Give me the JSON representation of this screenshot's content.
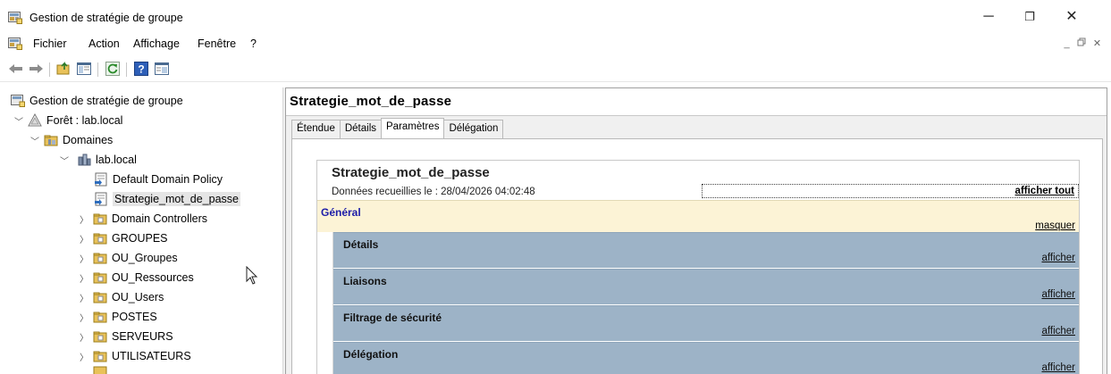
{
  "window": {
    "title": "Gestion de stratégie de groupe",
    "minimize_glyph": "─",
    "restore_glyph": "❐",
    "close_glyph": "✕"
  },
  "menu": {
    "items": [
      "Fichier",
      "Action",
      "Affichage",
      "Fenêtre",
      "?"
    ],
    "mdi_minimize": "_",
    "mdi_restore": "ₑ",
    "mdi_close": "✕"
  },
  "toolbar": {
    "icons": [
      "back-arrow-icon",
      "forward-arrow-icon",
      "up-folder-icon",
      "show-hide-tree-icon",
      "refresh-icon",
      "help-icon",
      "properties-icon"
    ]
  },
  "tree": {
    "root": "Gestion de stratégie de groupe",
    "forest": "Forêt : lab.local",
    "domains": "Domaines",
    "domain": "lab.local",
    "gpos": [
      "Default Domain Policy",
      "Strategie_mot_de_passe"
    ],
    "ous": [
      "Domain Controllers",
      "GROUPES",
      "OU_Groupes",
      "OU_Ressources",
      "OU_Users",
      "POSTES",
      "SERVEURS",
      "UTILISATEURS"
    ]
  },
  "right": {
    "gpo_title": "Strategie_mot_de_passe",
    "tabs": [
      "Étendue",
      "Détails",
      "Paramètres",
      "Délégation"
    ],
    "active_tab": "Paramètres",
    "report": {
      "title": "Strategie_mot_de_passe",
      "date": "Données recueillies le : 28/04/2026 04:02:48",
      "show_all": "afficher tout",
      "general": "Général",
      "hide": "masquer",
      "sections": [
        {
          "label": "Détails",
          "action": "afficher"
        },
        {
          "label": "Liaisons",
          "action": "afficher"
        },
        {
          "label": "Filtrage de sécurité",
          "action": "afficher"
        },
        {
          "label": "Délégation",
          "action": "afficher"
        }
      ]
    }
  },
  "colors": {
    "general_bg": "#fcf3d6",
    "general_text": "#1c1ca8",
    "section_bg": "#9db3c7",
    "selection": "#e5e5e5"
  }
}
